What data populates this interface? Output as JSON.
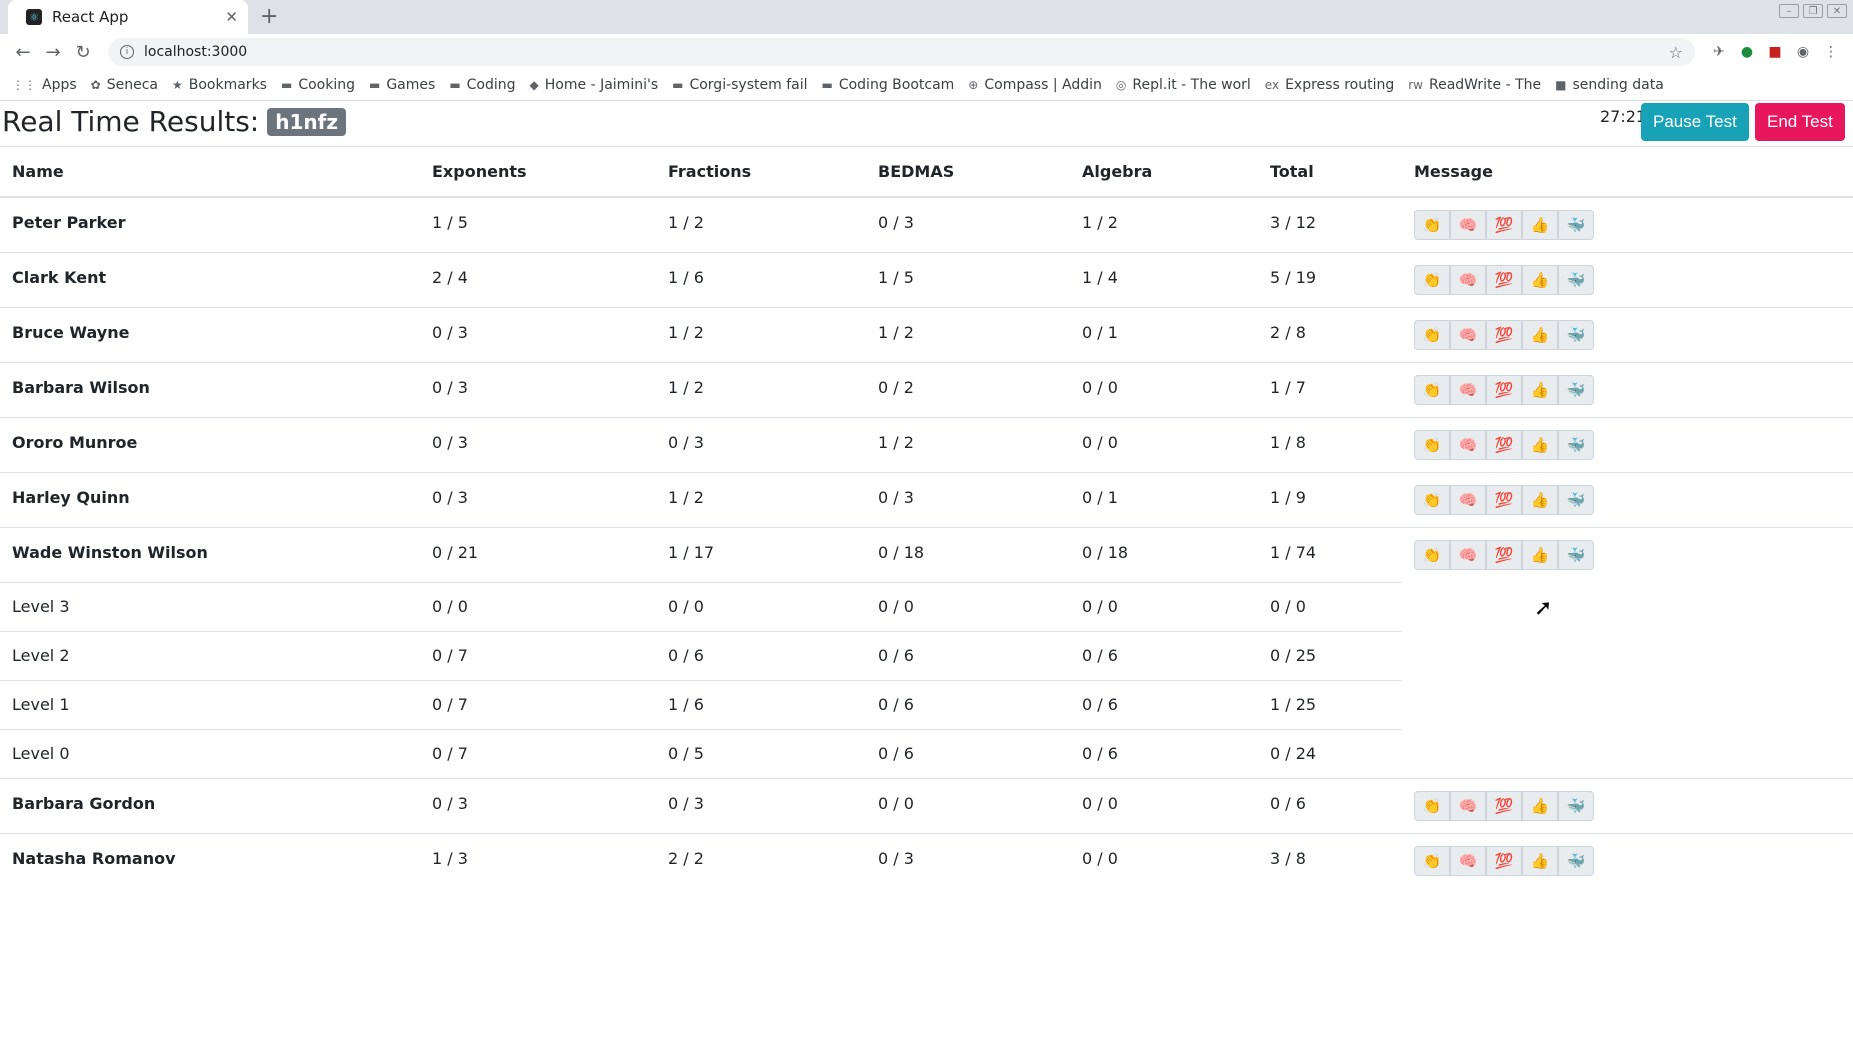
{
  "browser": {
    "tab_title": "React App",
    "new_tab": "+",
    "url": "localhost:3000",
    "bookmarks": [
      "Apps",
      "Seneca",
      "Bookmarks",
      "Cooking",
      "Games",
      "Coding",
      "Home - Jaimini's",
      "Corgi-system fail",
      "Coding Bootcam",
      "Compass | Addin",
      "Repl.it - The worl",
      "Express routing",
      "ReadWrite - The",
      "sending data"
    ]
  },
  "header": {
    "title": "Real Time Results:",
    "code": "h1nfz",
    "timer": "27:21",
    "pause_label": "Pause Test",
    "end_label": "End Test"
  },
  "table": {
    "columns": [
      "Name",
      "Exponents",
      "Fractions",
      "BEDMAS",
      "Algebra",
      "Total",
      "Message"
    ],
    "rows": [
      {
        "kind": "student",
        "cells": [
          "Peter Parker",
          "1 / 5",
          "1 / 2",
          "0 / 3",
          "1 / 2",
          "3 / 12"
        ]
      },
      {
        "kind": "student",
        "cells": [
          "Clark Kent",
          "2 / 4",
          "1 / 6",
          "1 / 5",
          "1 / 4",
          "5 / 19"
        ]
      },
      {
        "kind": "student",
        "cells": [
          "Bruce Wayne",
          "0 / 3",
          "1 / 2",
          "1 / 2",
          "0 / 1",
          "2 / 8"
        ]
      },
      {
        "kind": "student",
        "cells": [
          "Barbara Wilson",
          "0 / 3",
          "1 / 2",
          "0 / 2",
          "0 / 0",
          "1 / 7"
        ]
      },
      {
        "kind": "student",
        "cells": [
          "Ororo Munroe",
          "0 / 3",
          "0 / 3",
          "1 / 2",
          "0 / 0",
          "1 / 8"
        ]
      },
      {
        "kind": "student",
        "cells": [
          "Harley Quinn",
          "0 / 3",
          "1 / 2",
          "0 / 3",
          "0 / 1",
          "1 / 9"
        ]
      },
      {
        "kind": "student",
        "cells": [
          "Wade Winston Wilson",
          "0 / 21",
          "1 / 17",
          "0 / 18",
          "0 / 18",
          "1 / 74"
        ]
      },
      {
        "kind": "level",
        "cells": [
          "Level 3",
          "0 / 0",
          "0 / 0",
          "0 / 0",
          "0 / 0",
          "0 / 0"
        ]
      },
      {
        "kind": "level",
        "cells": [
          "Level 2",
          "0 / 7",
          "0 / 6",
          "0 / 6",
          "0 / 6",
          "0 / 25"
        ]
      },
      {
        "kind": "level",
        "cells": [
          "Level 1",
          "0 / 7",
          "1 / 6",
          "0 / 6",
          "0 / 6",
          "1 / 25"
        ]
      },
      {
        "kind": "level",
        "cells": [
          "Level 0",
          "0 / 7",
          "0 / 5",
          "0 / 6",
          "0 / 6",
          "0 / 24"
        ]
      },
      {
        "kind": "student",
        "cells": [
          "Barbara Gordon",
          "0 / 3",
          "0 / 3",
          "0 / 0",
          "0 / 0",
          "0 / 6"
        ]
      },
      {
        "kind": "student",
        "cells": [
          "Natasha Romanov",
          "1 / 3",
          "2 / 2",
          "0 / 3",
          "0 / 0",
          "3 / 8"
        ]
      }
    ],
    "message_emojis": [
      {
        "name": "clap",
        "glyph": "👏"
      },
      {
        "name": "brain",
        "glyph": "🧠"
      },
      {
        "name": "hundred",
        "glyph": "💯"
      },
      {
        "name": "thumbs-up",
        "glyph": "👍"
      },
      {
        "name": "whale",
        "glyph": "🐳"
      }
    ]
  },
  "colors": {
    "pause": "#17a2b8",
    "end": "#e8175d",
    "badge": "#6c757d"
  }
}
